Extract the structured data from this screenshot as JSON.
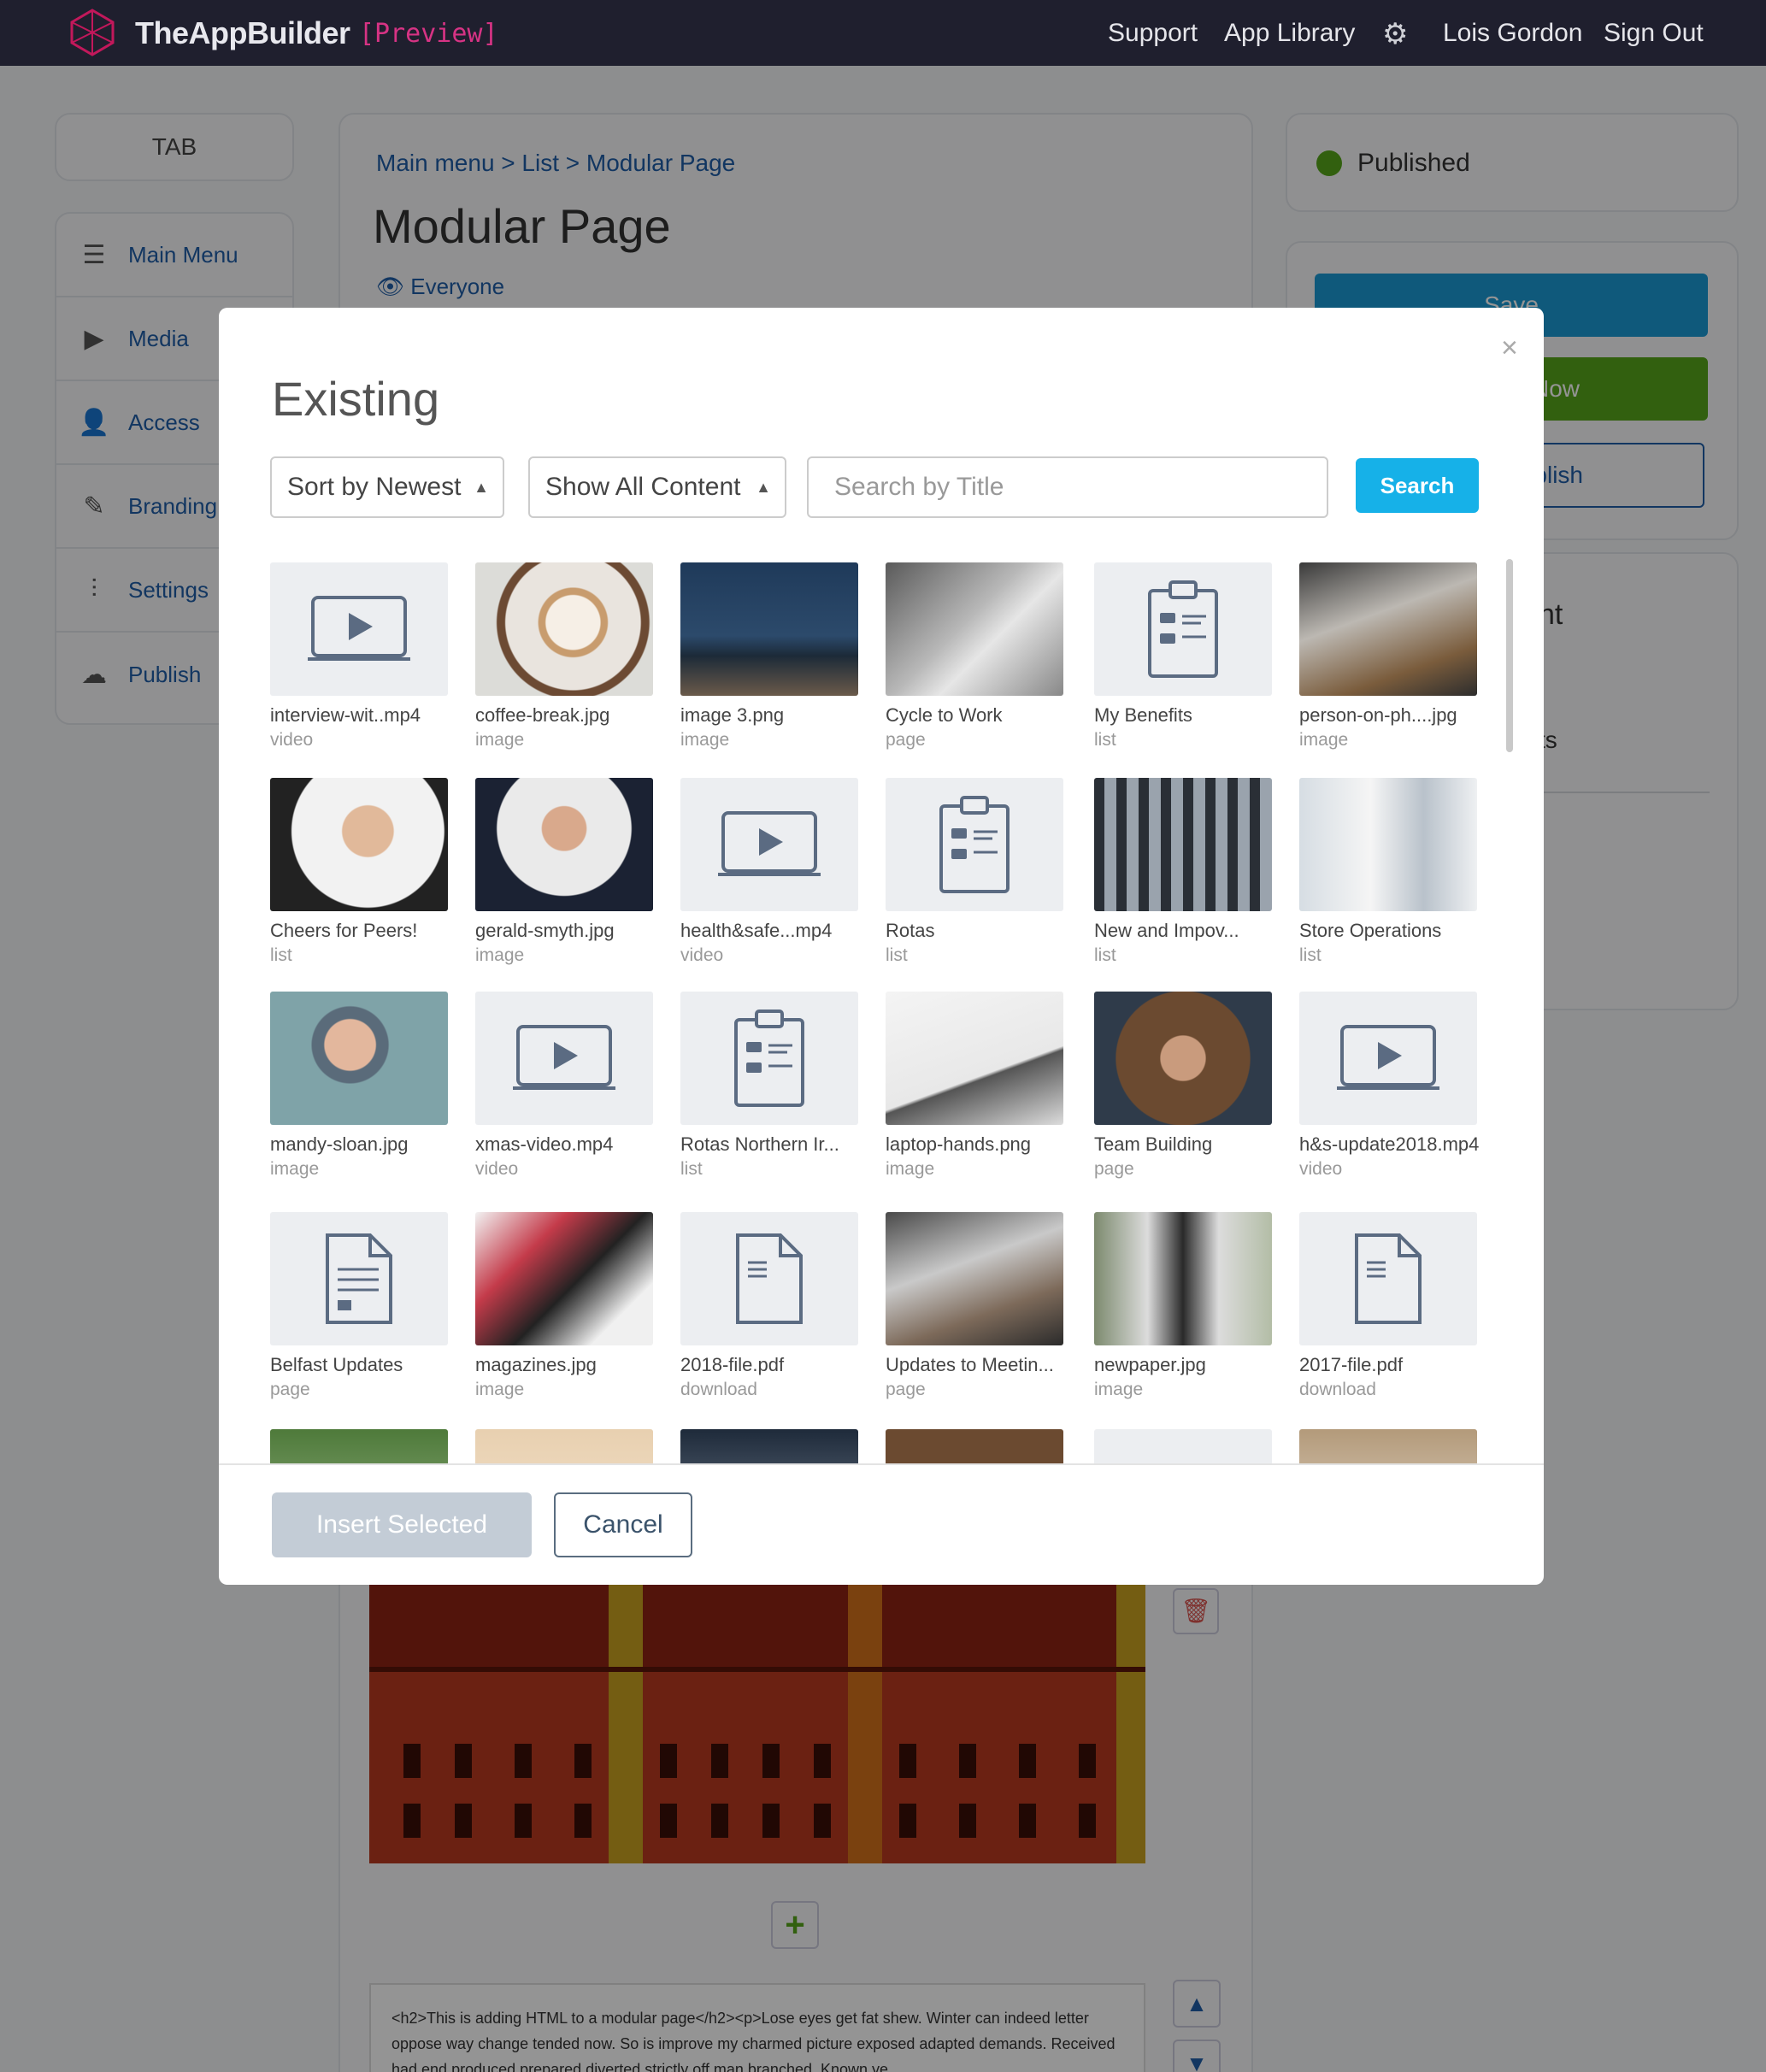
{
  "header": {
    "brand": "TheAppBuilder",
    "brand_tag": "[Preview]",
    "nav": {
      "support": "Support",
      "app_library": "App Library",
      "user": "Lois Gordon",
      "sign_out": "Sign Out"
    },
    "gear_icon": "gear-icon"
  },
  "sidebar": {
    "tab_label": "TAB",
    "items": [
      {
        "label": "Main Menu",
        "icon": "menu-icon"
      },
      {
        "label": "Media",
        "icon": "play-icon"
      },
      {
        "label": "Access",
        "icon": "user-icon"
      },
      {
        "label": "Branding",
        "icon": "brush-icon"
      },
      {
        "label": "Settings",
        "icon": "sliders-icon"
      },
      {
        "label": "Publish",
        "icon": "cloud-upload-icon"
      }
    ]
  },
  "main": {
    "breadcrumb": "Main menu > List > Modular Page",
    "title": "Modular Page",
    "visibility": "Everyone",
    "html_snippet": "<h2>This is adding HTML to a modular page</h2><p>Lose eyes get fat shew. Winter can indeed letter oppose way change tended now. So is improve my charmed picture exposed adapted demands. Received had end produced prepared diverted strictly off man branched. Known ye"
  },
  "right_panel": {
    "status": "Published",
    "status_color": "#56a61a",
    "save": "Save",
    "publish_now": "h Now",
    "publish": "Publish",
    "partial_heading": "nt",
    "partial_text": "ts"
  },
  "modal": {
    "title": "Existing",
    "sort_select": "Sort by Newest",
    "filter_select": "Show All Content",
    "search_placeholder": "Search by Title",
    "search_button": "Search",
    "insert_button": "Insert Selected",
    "cancel_button": "Cancel",
    "items": [
      {
        "name": "interview-wit..mp4",
        "type": "video"
      },
      {
        "name": "coffee-break.jpg",
        "type": "image"
      },
      {
        "name": "image 3.png",
        "type": "image"
      },
      {
        "name": "Cycle to Work",
        "type": "page"
      },
      {
        "name": "My Benefits",
        "type": "list"
      },
      {
        "name": "person-on-ph....jpg",
        "type": "image"
      },
      {
        "name": "Cheers for Peers!",
        "type": "list"
      },
      {
        "name": "gerald-smyth.jpg",
        "type": "image"
      },
      {
        "name": "health&safe...mp4",
        "type": "video"
      },
      {
        "name": "Rotas",
        "type": "list"
      },
      {
        "name": "New and Impov...",
        "type": "list"
      },
      {
        "name": "Store Operations",
        "type": "list"
      },
      {
        "name": "mandy-sloan.jpg",
        "type": "image"
      },
      {
        "name": "xmas-video.mp4",
        "type": "video"
      },
      {
        "name": "Rotas Northern Ir...",
        "type": "list"
      },
      {
        "name": "laptop-hands.png",
        "type": "image"
      },
      {
        "name": "Team Building",
        "type": "page"
      },
      {
        "name": "h&s-update2018.mp4",
        "type": "video"
      },
      {
        "name": "Belfast Updates",
        "type": "page"
      },
      {
        "name": "magazines.jpg",
        "type": "image"
      },
      {
        "name": "2018-file.pdf",
        "type": "download"
      },
      {
        "name": "Updates to Meetin...",
        "type": "page"
      },
      {
        "name": "newpaper.jpg",
        "type": "image"
      },
      {
        "name": "2017-file.pdf",
        "type": "download"
      }
    ]
  }
}
